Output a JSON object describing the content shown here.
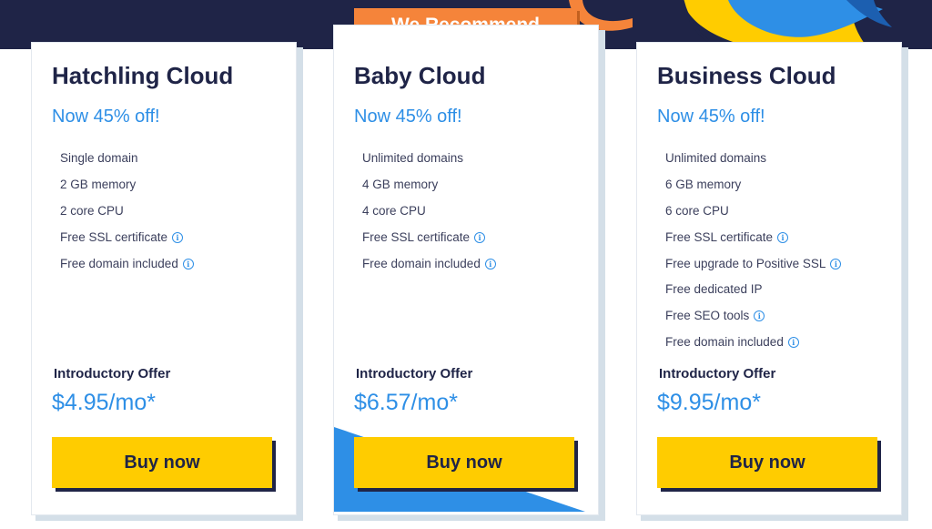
{
  "header": {
    "recommend_badge": "We Recommend"
  },
  "colors": {
    "navy": "#1f2447",
    "accent_blue": "#2e8fe6",
    "button_yellow": "#ffcc00",
    "badge_orange": "#f5843a"
  },
  "plans": [
    {
      "name": "Hatchling Cloud",
      "discount": "Now 45% off!",
      "features": [
        {
          "label": "Single domain",
          "info": false
        },
        {
          "label": "2 GB memory",
          "info": false
        },
        {
          "label": "2 core CPU",
          "info": false
        },
        {
          "label": "Free SSL certificate",
          "info": true
        },
        {
          "label": "Free domain included",
          "info": true
        }
      ],
      "offer_label": "Introductory Offer",
      "price": "$4.95/mo*",
      "button_label": "Buy now"
    },
    {
      "name": "Baby Cloud",
      "discount": "Now 45% off!",
      "features": [
        {
          "label": "Unlimited domains",
          "info": false
        },
        {
          "label": "4 GB memory",
          "info": false
        },
        {
          "label": "4 core CPU",
          "info": false
        },
        {
          "label": "Free SSL certificate",
          "info": true
        },
        {
          "label": "Free domain included",
          "info": true
        }
      ],
      "offer_label": "Introductory Offer",
      "price": "$6.57/mo*",
      "button_label": "Buy now"
    },
    {
      "name": "Business Cloud",
      "discount": "Now 45% off!",
      "features": [
        {
          "label": "Unlimited domains",
          "info": false
        },
        {
          "label": "6 GB memory",
          "info": false
        },
        {
          "label": "6 core CPU",
          "info": false
        },
        {
          "label": "Free SSL certificate",
          "info": true
        },
        {
          "label": "Free upgrade to Positive SSL",
          "info": true
        },
        {
          "label": "Free dedicated IP",
          "info": false
        },
        {
          "label": "Free SEO tools",
          "info": true
        },
        {
          "label": "Free domain included",
          "info": true
        }
      ],
      "offer_label": "Introductory Offer",
      "price": "$9.95/mo*",
      "button_label": "Buy now"
    }
  ]
}
